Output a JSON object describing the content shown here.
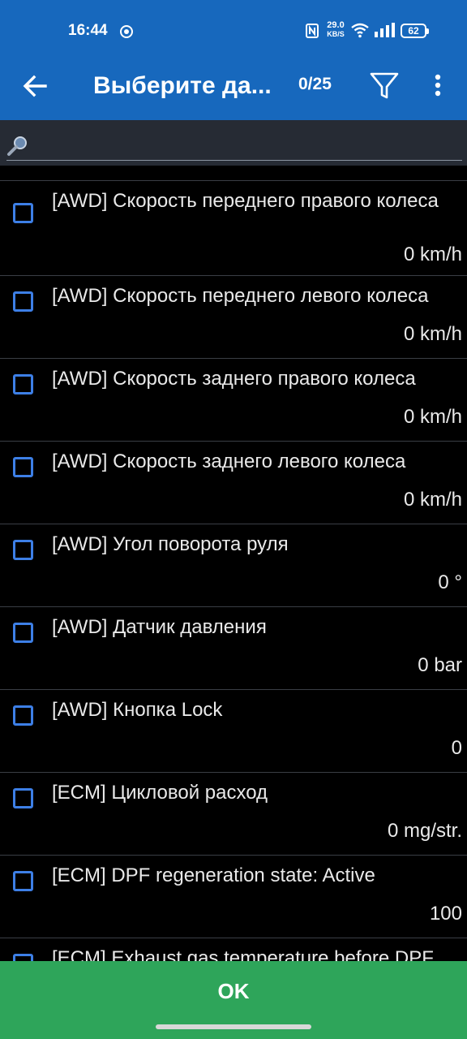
{
  "status_bar": {
    "time": "16:44",
    "speed_top": "29.0",
    "speed_bottom": "KB/S",
    "battery": "62"
  },
  "app_bar": {
    "title": "Выберите да...",
    "counter": "0/25"
  },
  "search": {
    "placeholder": "",
    "value": ""
  },
  "items": [
    {
      "label": "[AWD] Скорость переднего правого колеса",
      "value": "0 km/h",
      "checked": false
    },
    {
      "label": "[AWD] Скорость переднего левого колеса",
      "value": "0 km/h",
      "checked": false
    },
    {
      "label": "[AWD] Скорость заднего правого колеса",
      "value": "0 km/h",
      "checked": false
    },
    {
      "label": "[AWD] Скорость заднего левого колеса",
      "value": "0 km/h",
      "checked": false
    },
    {
      "label": "[AWD] Угол поворота руля",
      "value": "0 °",
      "checked": false
    },
    {
      "label": "[AWD] Датчик давления",
      "value": "0 bar",
      "checked": false
    },
    {
      "label": "[AWD] Кнопка Lock",
      "value": "0",
      "checked": false
    },
    {
      "label": "[ECM] Цикловой расход",
      "value": "0 mg/str.",
      "checked": false
    },
    {
      "label": "[ECM] DPF regeneration state: Active",
      "value": "100",
      "checked": false
    },
    {
      "label": "[ECM] Exhaust gas temperature before DPF",
      "value": "",
      "checked": false
    }
  ],
  "ok_button": {
    "label": "OK"
  },
  "colors": {
    "app_bar": "#1768bd",
    "accent_checkbox": "#3d7fe6",
    "ok_button": "#2ea55a",
    "search_bar": "#262b34"
  }
}
